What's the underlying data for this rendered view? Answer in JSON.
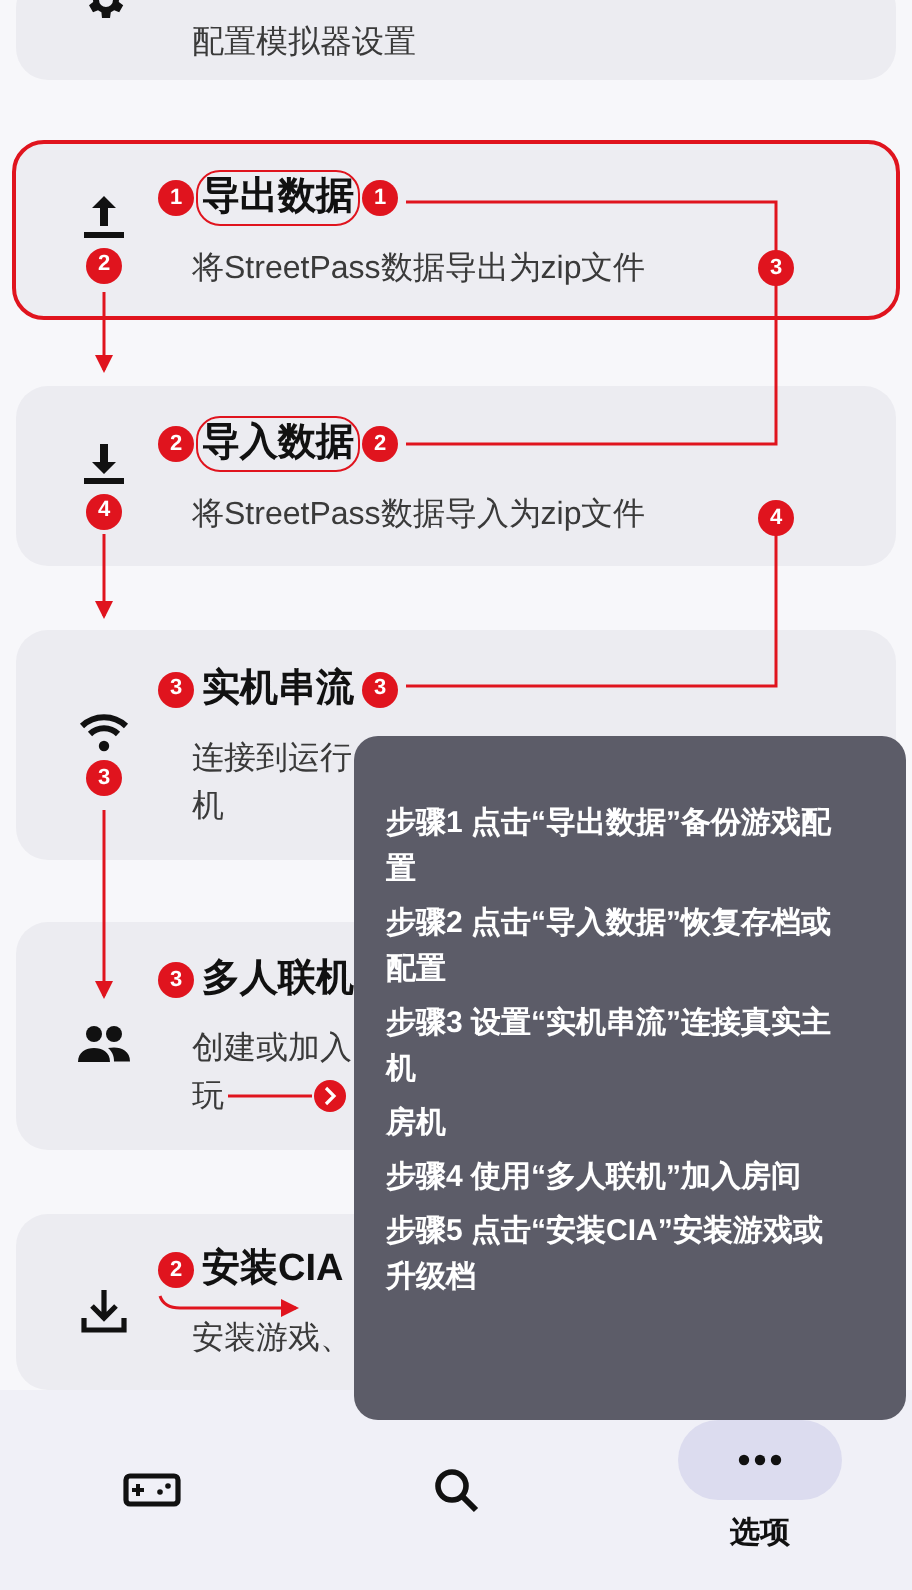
{
  "cards": [
    {
      "kind": "gear",
      "description": [
        "配置模拟器设置"
      ]
    },
    {
      "kind": "export",
      "title": "导出数据",
      "description": [
        "将StreetPass数据导出为zip文件"
      ],
      "highlighted": true,
      "title_outlined": true,
      "title_badges": [
        "1",
        "1"
      ],
      "icon_badge": "2",
      "side_badge": "3"
    },
    {
      "kind": "import",
      "title": "导入数据",
      "description": [
        "将StreetPass数据导入为zip文件"
      ],
      "highlighted": false,
      "title_outlined": true,
      "title_badges": [
        "2",
        "2"
      ],
      "icon_badge": "4",
      "side_badge": "4"
    },
    {
      "kind": "wifi",
      "title": "实机串流",
      "description": [
        "连接到运行",
        "机"
      ],
      "highlighted": false,
      "title_outlined": false,
      "title_badges": [
        "3",
        "3"
      ],
      "icon_badge": "3"
    },
    {
      "kind": "people",
      "title": "多人联机",
      "description": [
        "创建或加入",
        "玩"
      ],
      "highlighted": false,
      "title_outlined": false,
      "title_badges": [
        "3"
      ],
      "pointer": true
    },
    {
      "kind": "download",
      "title": "安装CIA",
      "description": [
        "安装游戏、"
      ],
      "highlighted": false,
      "title_outlined": false,
      "title_badges": [
        "2"
      ],
      "pointer": true
    }
  ],
  "tooltip": {
    "steps": [
      "步骤1 点击“导出数据”备份游戏配置",
      "步骤2 点击“导入数据”恢复存档或配置",
      "步骤3 设置“实机串流”连接真实主机",
      "房机",
      "步骤4 使用“多人联机”加入房间",
      "步骤5 点击“安装CIA”安装游戏或升级档"
    ]
  },
  "nav": [
    {
      "kind": "gamepad",
      "selected": false
    },
    {
      "kind": "search",
      "selected": false
    },
    {
      "kind": "more",
      "label": "选项",
      "selected": true
    }
  ]
}
